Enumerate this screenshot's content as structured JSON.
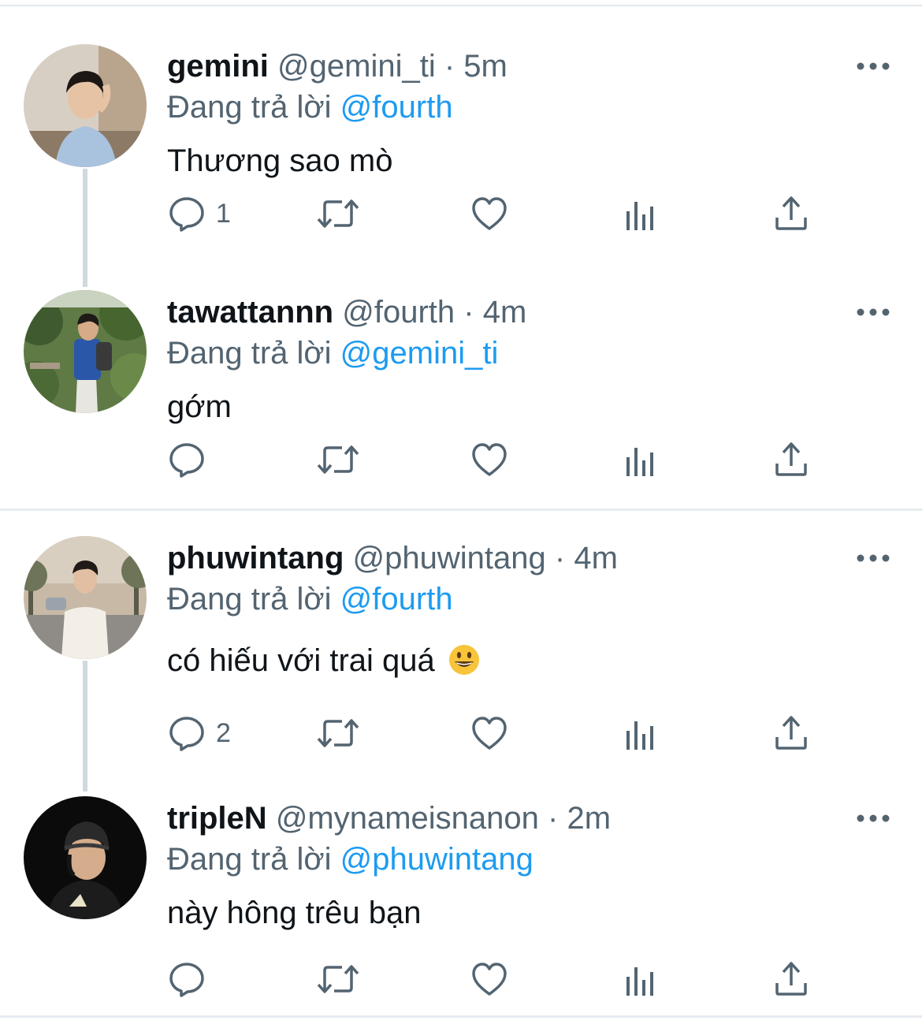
{
  "threads": [
    {
      "tweets": [
        {
          "name": "gemini",
          "handle": "@gemini_ti",
          "separator": "·",
          "time": "5m",
          "reply_prefix": "Đang trả lời",
          "reply_to": "@fourth",
          "text": "Thương sao mò",
          "reply_count": "1",
          "avatar": "man-light-shirt-avatar"
        },
        {
          "name": "tawattannn",
          "handle": "@fourth",
          "separator": "·",
          "time": "4m",
          "reply_prefix": "Đang trả lời",
          "reply_to": "@gemini_ti",
          "text": "gớm",
          "reply_count": "",
          "avatar": "man-garden-backpack-avatar"
        }
      ]
    },
    {
      "tweets": [
        {
          "name": "phuwintang",
          "handle": "@phuwintang",
          "separator": "·",
          "time": "4m",
          "reply_prefix": "Đang trả lời",
          "reply_to": "@fourth",
          "text": "có hiếu với trai quá",
          "emoji": "grinning-face-emoji",
          "reply_count": "2",
          "avatar": "man-street-white-shirt-avatar"
        },
        {
          "name": "tripleN",
          "handle": "@mynameisnanon",
          "separator": "·",
          "time": "2m",
          "reply_prefix": "Đang trả lời",
          "reply_to": "@phuwintang",
          "text": "này hông trêu bạn",
          "reply_count": "",
          "avatar": "man-black-cap-avatar"
        }
      ]
    }
  ],
  "icons": [
    "reply-icon",
    "retweet-icon",
    "like-icon",
    "analytics-icon",
    "share-icon",
    "more-icon"
  ],
  "colors": {
    "text": "#0f1419",
    "secondary": "#536471",
    "link": "#1d9bf0",
    "icon": "#536471",
    "divider": "#e6ecf0",
    "connector": "#cfd9de"
  }
}
